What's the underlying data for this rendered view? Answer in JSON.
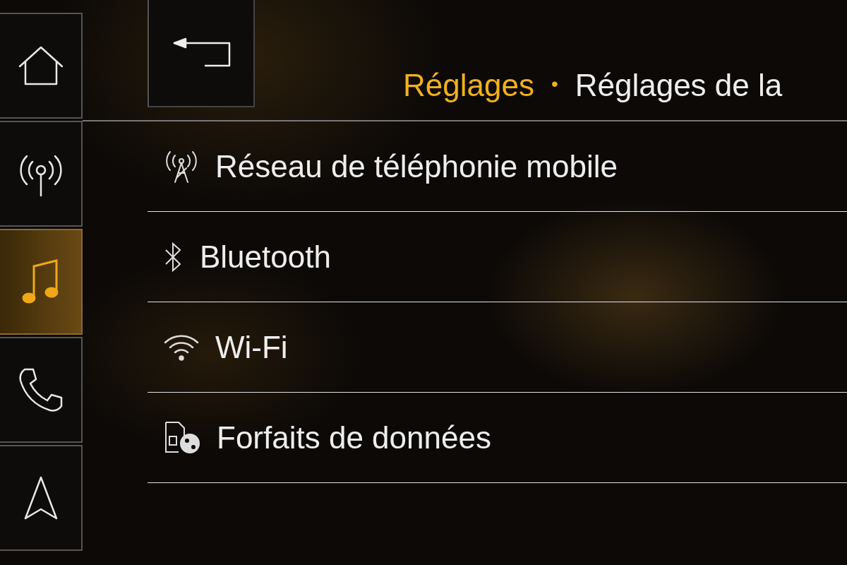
{
  "sidebar": {
    "items": [
      {
        "kind": "home",
        "selected": false
      },
      {
        "kind": "radio",
        "selected": false
      },
      {
        "kind": "music",
        "selected": true
      },
      {
        "kind": "phone",
        "selected": false
      },
      {
        "kind": "navigation",
        "selected": false
      }
    ]
  },
  "header": {
    "back": {
      "kind": "back"
    },
    "breadcrumb": [
      {
        "text": "Réglages",
        "kind": "parent"
      },
      {
        "text": "•",
        "kind": "separator"
      },
      {
        "text": "Réglages de la",
        "kind": "current"
      }
    ]
  },
  "menu": {
    "items": [
      {
        "label": "Réseau de téléphonie mobile",
        "kind": "cellular"
      },
      {
        "label": "Bluetooth",
        "kind": "bluetooth"
      },
      {
        "label": "Wi-Fi",
        "kind": "wifi"
      },
      {
        "label": "Forfaits de données",
        "kind": "data"
      }
    ]
  }
}
